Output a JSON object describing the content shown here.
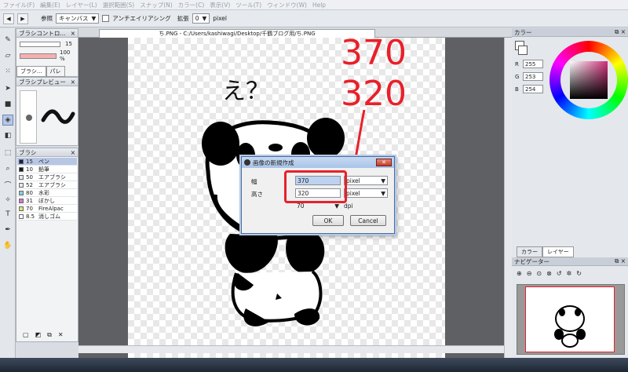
{
  "menu": [
    "ファイル(F)",
    "編集(E)",
    "レイヤー(L)",
    "選択範囲(S)",
    "スナップ(N)",
    "カラー(C)",
    "表示(V)",
    "ツール(T)",
    "ウィンドウ(W)",
    "Help"
  ],
  "toolbar": {
    "ref_label": "参照",
    "ref_value": "キャンバス",
    "antialias_label": "アンチエイリアシング",
    "zoom_label": "拡張",
    "zoom_value": "0",
    "zoom_unit": "pixel"
  },
  "brush_control": {
    "title": "ブラシコントロ...",
    "size": "15",
    "opacity": "100 %",
    "tab1": "ブラシ...",
    "tab2": "パレ"
  },
  "brush_preview": {
    "title": "ブラシプレビュー"
  },
  "brushes": {
    "title": "ブラシ",
    "items": [
      {
        "size": "15",
        "name": "ペン",
        "color": "#1a1a50"
      },
      {
        "size": "10",
        "name": "鉛筆",
        "color": "#1a1a1a"
      },
      {
        "size": "50",
        "name": "エアブラシ",
        "color": "#e8e8e8"
      },
      {
        "size": "52",
        "name": "エアブラシ",
        "color": "#e8e8e8"
      },
      {
        "size": "80",
        "name": "水彩",
        "color": "#7fd4e8"
      },
      {
        "size": "31",
        "name": "ぼかし",
        "color": "#e070e0"
      },
      {
        "size": "70",
        "name": "FireAlpac",
        "color": "#e8e070"
      },
      {
        "size": "8.5",
        "name": "消しゴム",
        "color": "#ffffff"
      }
    ]
  },
  "document": {
    "tab_title": "ち.PNG - C:/Users/kashiwagi/Desktop/千鶴ブログ用/ち.PNG"
  },
  "drawing": {
    "speech": "え？"
  },
  "annotation": {
    "line1": "370",
    "line2": "320"
  },
  "dialog": {
    "title": "画像の新規作成",
    "width_label": "幅",
    "width_value": "370",
    "height_label": "高さ",
    "height_value": "320",
    "unit": "pixel",
    "dpi_value": "70",
    "dpi_unit": "dpi",
    "ok": "OK",
    "cancel": "Cancel"
  },
  "color_panel": {
    "title": "カラー",
    "r_label": "R",
    "r": "255",
    "g_label": "G",
    "g": "253",
    "b_label": "B",
    "b": "254",
    "tab_color": "カラー",
    "tab_layer": "レイヤー"
  },
  "navigator": {
    "title": "ナビゲーター"
  }
}
